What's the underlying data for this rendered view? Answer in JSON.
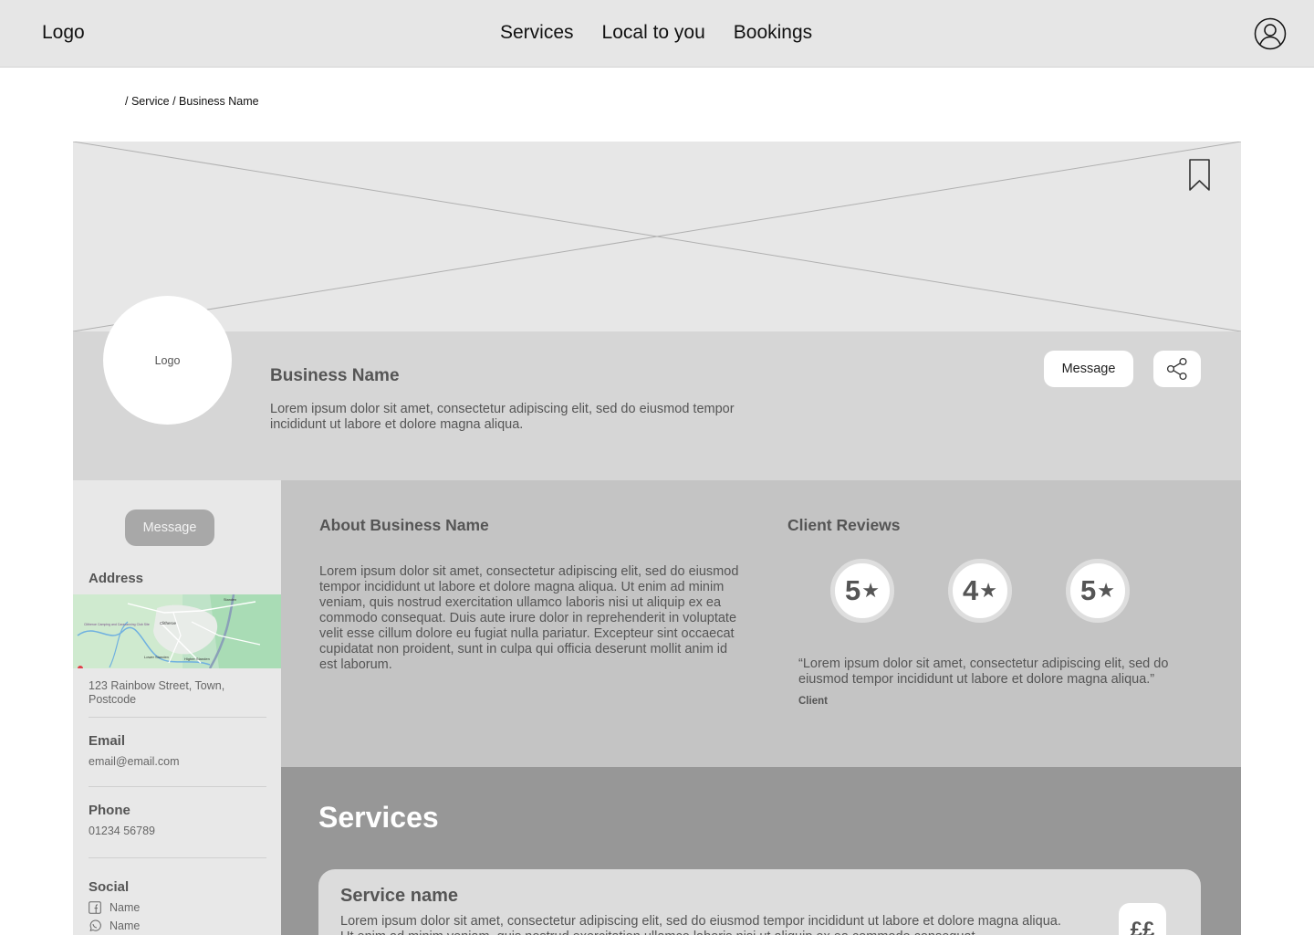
{
  "header": {
    "logo": "Logo",
    "nav": [
      "Services",
      "Local to you",
      "Bookings"
    ],
    "account_icon": "user-circle-icon"
  },
  "breadcrumb": "/ Service / Business Name",
  "hero": {
    "bookmark_icon": "bookmark-icon"
  },
  "profile": {
    "logo_text": "Logo",
    "name": "Business Name",
    "description": "Lorem ipsum dolor sit amet, consectetur adipiscing elit, sed do eiusmod tempor incididunt ut labore et dolore magna aliqua.",
    "message_label": "Message",
    "share_icon": "share-icon"
  },
  "sidebar": {
    "message_label": "Message",
    "address_label": "Address",
    "map_labels": [
      "Clitheroe",
      "Lower Standen",
      "Higher Standen",
      "Clitheroe Camping and Caravanning Club Site",
      "Standen"
    ],
    "address_value": "123 Rainbow Street, Town, Postcode",
    "email_label": "Email",
    "email_value": "email@email.com",
    "phone_label": "Phone",
    "phone_value": "01234 56789",
    "social_label": "Social",
    "social": [
      {
        "icon": "facebook-icon",
        "name": "Name"
      },
      {
        "icon": "whatsapp-icon",
        "name": "Name"
      }
    ]
  },
  "about": {
    "title": "About Business Name",
    "text": "Lorem ipsum dolor sit amet, consectetur adipiscing elit, sed do eiusmod tempor incididunt ut labore et dolore magna aliqua. Ut enim ad minim veniam, quis nostrud exercitation ullamco laboris nisi ut aliquip ex ea commodo consequat. Duis aute irure dolor in reprehenderit in voluptate velit esse cillum dolore eu fugiat nulla pariatur. Excepteur sint occaecat cupidatat non proident, sunt in culpa qui officia deserunt mollit anim id est laborum."
  },
  "reviews": {
    "title": "Client Reviews",
    "ratings": [
      "5",
      "4",
      "5"
    ],
    "star": "★",
    "quote": "“Lorem ipsum dolor sit amet, consectetur adipiscing elit, sed do eiusmod tempor incididunt ut labore et dolore magna aliqua.”",
    "author": "Client"
  },
  "services": {
    "title": "Services",
    "items": [
      {
        "name": "Service name",
        "description": "Lorem ipsum dolor sit amet, consectetur adipiscing elit, sed do eiusmod tempor incididunt ut labore et dolore magna aliqua. Ut enim ad minim veniam, quis nostrud exercitation ullamco laboris nisi ut aliquip ex ea commodo consequat.",
        "price": "££"
      }
    ]
  }
}
